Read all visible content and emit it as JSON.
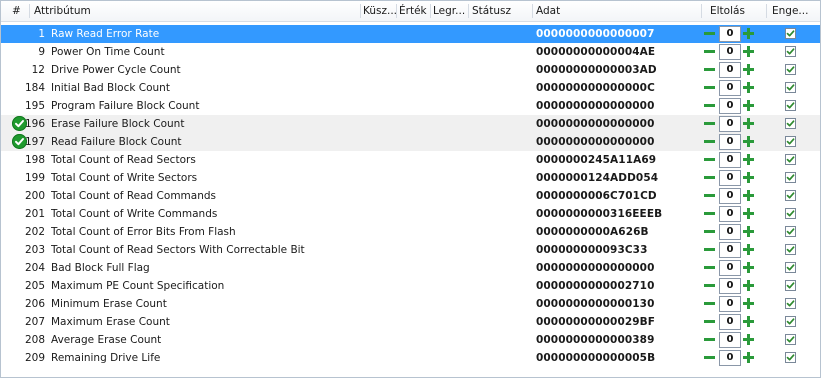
{
  "header": {
    "col_num": "#",
    "col_attribute": "Attribútum",
    "col_threshold": "Küsz...",
    "col_value": "Érték",
    "col_worst": "Legr...",
    "col_status": "Státusz",
    "col_data": "Adat",
    "col_offset": "Eltolás",
    "col_enable": "Enge..."
  },
  "rows": [
    {
      "id": "1",
      "name": "Raw Read Error Rate",
      "data": "0000000000000007",
      "offset": "0",
      "enabled": true,
      "status_ok": false,
      "selected": true
    },
    {
      "id": "9",
      "name": "Power On Time Count",
      "data": "00000000000004AE",
      "offset": "0",
      "enabled": true,
      "status_ok": false
    },
    {
      "id": "12",
      "name": "Drive Power Cycle Count",
      "data": "00000000000003AD",
      "offset": "0",
      "enabled": true,
      "status_ok": false
    },
    {
      "id": "184",
      "name": "Initial Bad Block Count",
      "data": "000000000000000C",
      "offset": "0",
      "enabled": true,
      "status_ok": false
    },
    {
      "id": "195",
      "name": "Program Failure Block Count",
      "data": "0000000000000000",
      "offset": "0",
      "enabled": true,
      "status_ok": false
    },
    {
      "id": "196",
      "name": "Erase Failure Block Count",
      "data": "0000000000000000",
      "offset": "0",
      "enabled": true,
      "status_ok": true
    },
    {
      "id": "197",
      "name": "Read Failure Block Count",
      "data": "0000000000000000",
      "offset": "0",
      "enabled": true,
      "status_ok": true
    },
    {
      "id": "198",
      "name": "Total Count of Read Sectors",
      "data": "0000000245A11A69",
      "offset": "0",
      "enabled": true,
      "status_ok": false
    },
    {
      "id": "199",
      "name": "Total Count of Write Sectors",
      "data": "0000000124ADD054",
      "offset": "0",
      "enabled": true,
      "status_ok": false
    },
    {
      "id": "200",
      "name": "Total Count of Read Commands",
      "data": "0000000006C701CD",
      "offset": "0",
      "enabled": true,
      "status_ok": false
    },
    {
      "id": "201",
      "name": "Total Count of Write Commands",
      "data": "0000000000316EEEB",
      "offset": "0",
      "enabled": true,
      "status_ok": false
    },
    {
      "id": "202",
      "name": "Total Count of Error Bits From Flash",
      "data": "0000000000A626B",
      "offset": "0",
      "enabled": true,
      "status_ok": false
    },
    {
      "id": "203",
      "name": "Total Count of Read Sectors With Correctable Bit",
      "data": "000000000093C33",
      "offset": "0",
      "enabled": true,
      "status_ok": false
    },
    {
      "id": "204",
      "name": "Bad Block Full Flag",
      "data": "0000000000000000",
      "offset": "0",
      "enabled": true,
      "status_ok": false
    },
    {
      "id": "205",
      "name": "Maximum PE Count Specification",
      "data": "0000000000002710",
      "offset": "0",
      "enabled": true,
      "status_ok": false
    },
    {
      "id": "206",
      "name": "Minimum Erase Count",
      "data": "0000000000000130",
      "offset": "0",
      "enabled": true,
      "status_ok": false
    },
    {
      "id": "207",
      "name": "Maximum Erase Count",
      "data": "00000000000029BF",
      "offset": "0",
      "enabled": true,
      "status_ok": false
    },
    {
      "id": "208",
      "name": "Average Erase Count",
      "data": "0000000000000389",
      "offset": "0",
      "enabled": true,
      "status_ok": false
    },
    {
      "id": "209",
      "name": "Remaining Drive Life",
      "data": "000000000000005B",
      "offset": "0",
      "enabled": true,
      "status_ok": false
    }
  ],
  "icons": {
    "status_ok": "check-circle-icon",
    "minus": "minus-icon",
    "plus": "plus-icon",
    "checkbox": "checkbox-checked-icon"
  },
  "colors": {
    "selection": "#3399ff",
    "zebra": "#f0f0f0",
    "status_ok": "#1f9a2e",
    "stepper_green": "#2a9a3a",
    "checkbox_check": "#2f8a2f"
  }
}
